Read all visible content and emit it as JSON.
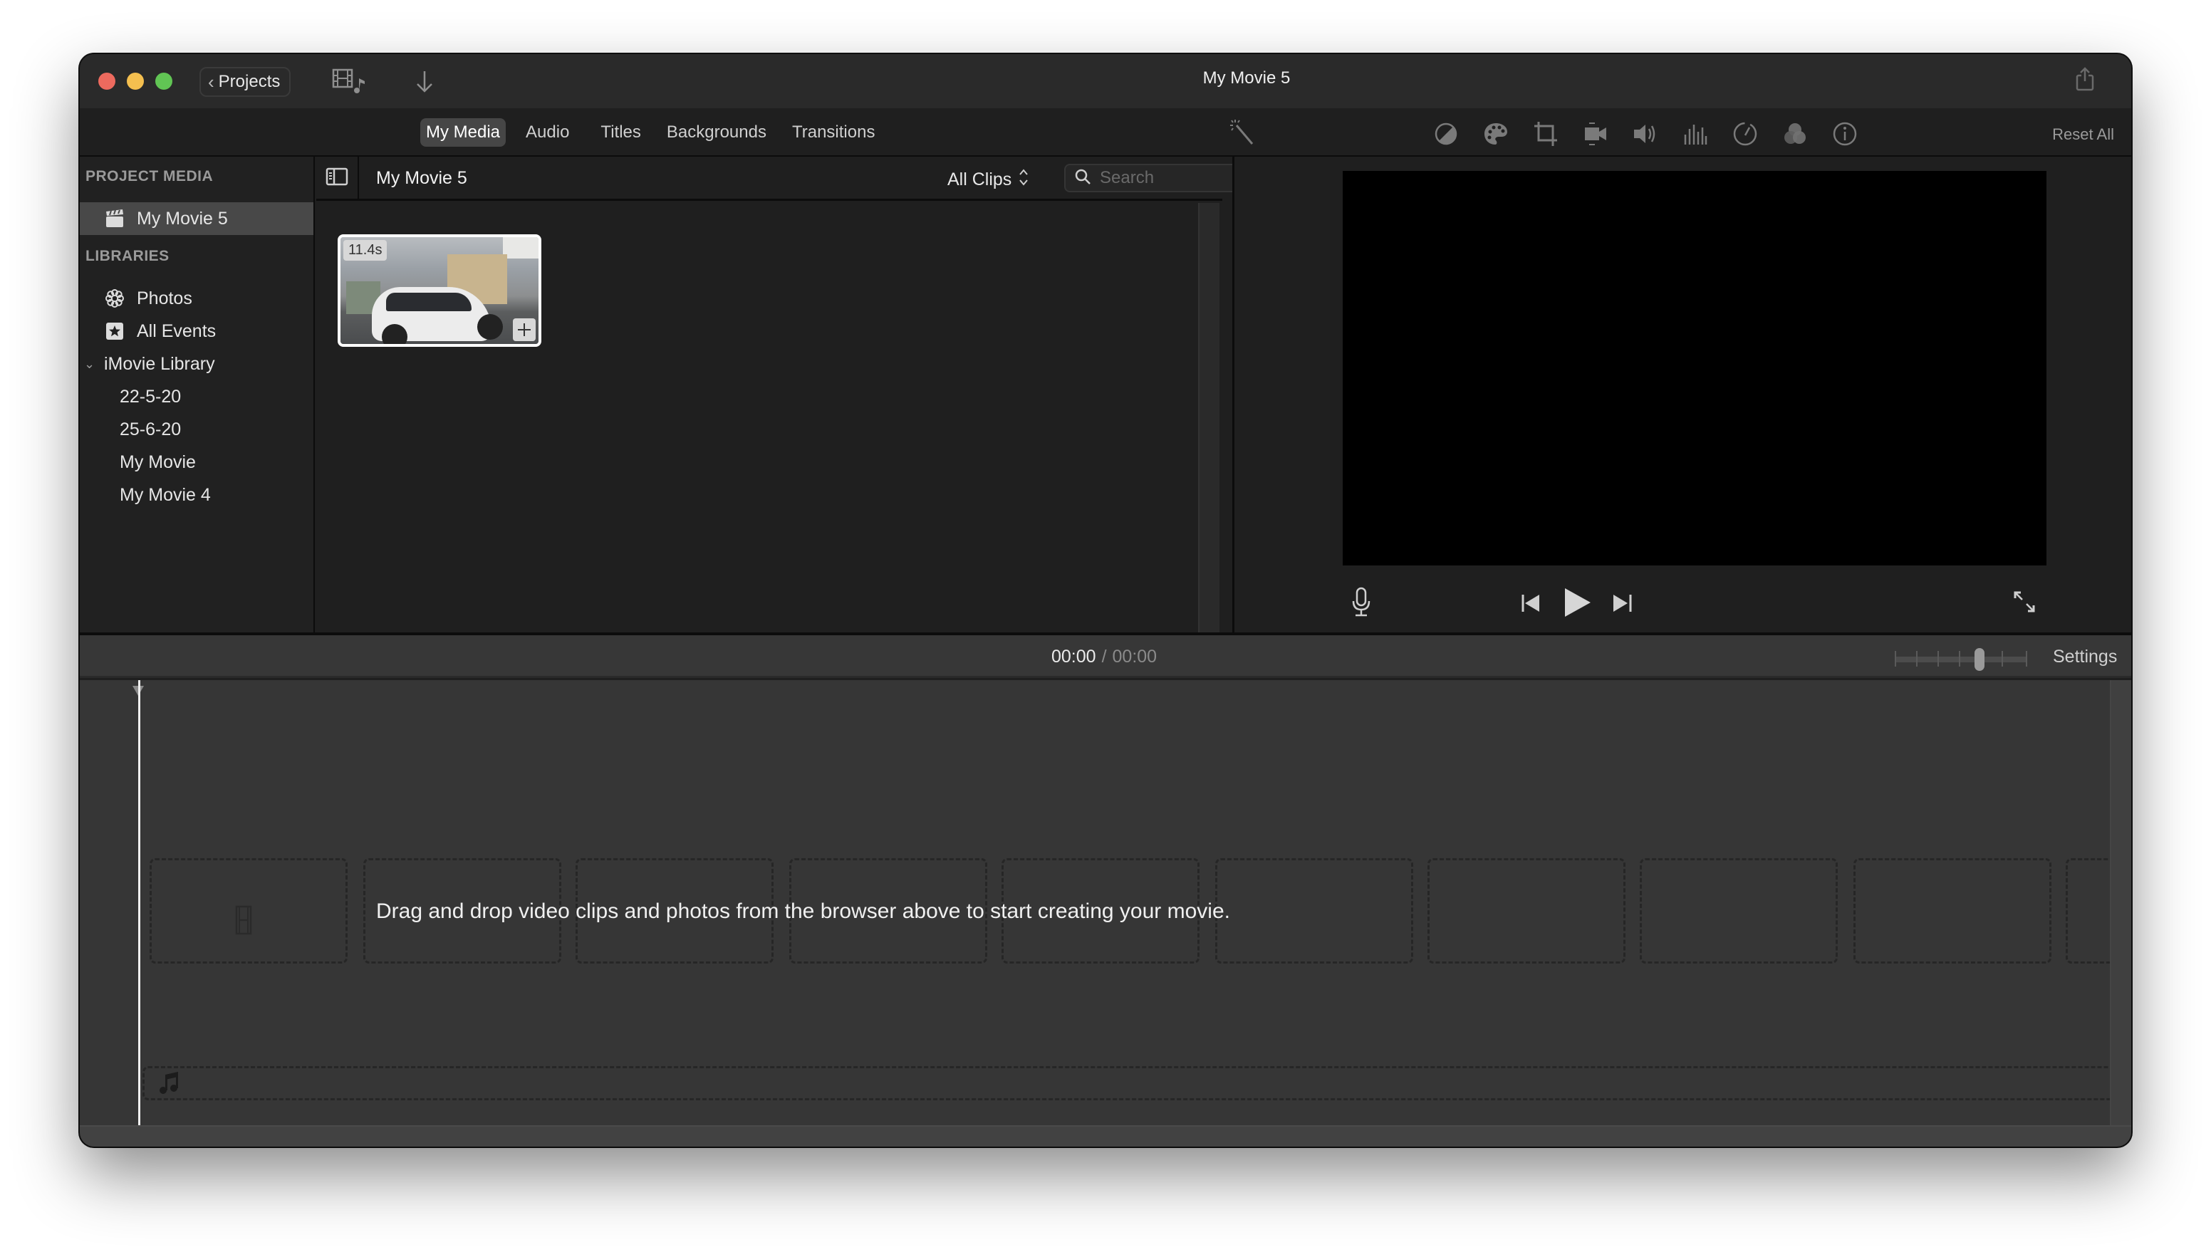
{
  "window": {
    "title": "My Movie 5",
    "traffic_lights": {
      "close": "#ed6a5e",
      "minimize": "#f4bf4f",
      "zoom": "#61c554"
    }
  },
  "toolbar": {
    "projects_label": "Projects",
    "media_toggle_icon": "film-music-icon",
    "import_icon": "arrow-down-icon",
    "share_icon": "share-icon"
  },
  "tabs": [
    {
      "label": "My Media",
      "active": true
    },
    {
      "label": "Audio",
      "active": false
    },
    {
      "label": "Titles",
      "active": false
    },
    {
      "label": "Backgrounds",
      "active": false
    },
    {
      "label": "Transitions",
      "active": false
    }
  ],
  "inspector": {
    "icons": [
      "magic-wand",
      "color-balance",
      "color-correction",
      "crop",
      "stabilization",
      "volume",
      "noise-reduction-equalizer",
      "speed",
      "clip-filter",
      "info"
    ],
    "reset_all_label": "Reset All"
  },
  "sidebar": {
    "project_media_heading": "PROJECT MEDIA",
    "project_item": "My Movie 5",
    "libraries_heading": "LIBRARIES",
    "library_items": [
      {
        "label": "Photos",
        "icon": "photos-flower-icon"
      },
      {
        "label": "All Events",
        "icon": "star-icon"
      }
    ],
    "library_name": "iMovie Library",
    "events": [
      "22-5-20",
      "25-6-20",
      "My Movie",
      "My Movie 4"
    ]
  },
  "browser": {
    "title": "My Movie 5",
    "filter_label": "All Clips",
    "search_placeholder": "Search",
    "search_value": "",
    "clips": [
      {
        "duration": "11.4s",
        "description": "white hatchback parked on street"
      }
    ]
  },
  "viewer": {
    "controls": [
      "microphone",
      "skip-back",
      "play",
      "skip-forward",
      "fullscreen"
    ]
  },
  "timeline": {
    "current_time": "00:00",
    "separator": "/",
    "total_time": "00:00",
    "zoom_level": 0.65,
    "settings_label": "Settings",
    "drop_hint": "Drag and drop video clips and photos from the browser above to start creating your movie."
  }
}
